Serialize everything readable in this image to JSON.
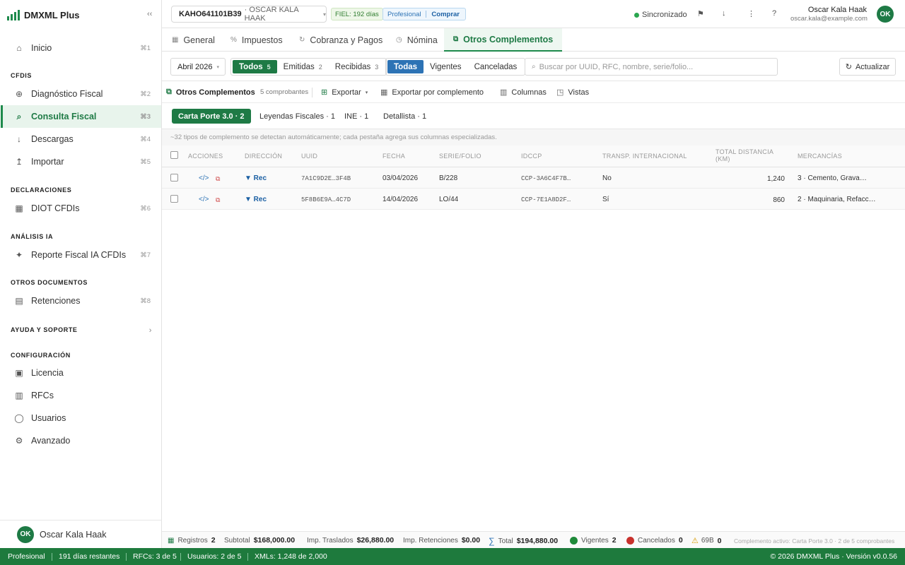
{
  "app": {
    "name": "DMXML Plus",
    "collapse_icon": "‹‹"
  },
  "sidebar": {
    "sections": {
      "cfdis": "CFDIS",
      "declaraciones": "DECLARACIONES",
      "analisis": "ANÁLISIS IA",
      "otros": "OTROS DOCUMENTOS",
      "ayuda": "AYUDA Y SOPORTE",
      "config": "CONFIGURACIÓN"
    },
    "items": {
      "inicio": {
        "label": "Inicio",
        "kbd": "⌘1",
        "icon": "home-icon"
      },
      "diagnostico": {
        "label": "Diagnóstico Fiscal",
        "kbd": "⌘2",
        "icon": "diagnostic-icon"
      },
      "consulta": {
        "label": "Consulta Fiscal",
        "kbd": "⌘3",
        "icon": "search-icon"
      },
      "descargas": {
        "label": "Descargas",
        "kbd": "⌘4",
        "icon": "download-icon"
      },
      "importar": {
        "label": "Importar",
        "kbd": "⌘5",
        "icon": "upload-icon"
      },
      "diot": {
        "label": "DIOT CFDIs",
        "kbd": "⌘6",
        "icon": "grid-icon"
      },
      "reporte": {
        "label": "Reporte Fiscal IA CFDIs",
        "kbd": "⌘7",
        "icon": "sparkle-icon"
      },
      "retenciones": {
        "label": "Retenciones",
        "kbd": "⌘8",
        "icon": "document-icon"
      },
      "licencia": {
        "label": "Licencia",
        "icon": "license-icon"
      },
      "rfcs": {
        "label": "RFCs",
        "icon": "building-icon"
      },
      "usuarios": {
        "label": "Usuarios",
        "icon": "users-icon"
      },
      "avanzado": {
        "label": "Avanzado",
        "icon": "gear-icon"
      }
    },
    "ayuda_chevron": "›",
    "user": {
      "initials": "OK",
      "name": "Oscar Kala Haak"
    }
  },
  "topbar": {
    "rfc": "KAHO641101B39",
    "rfc_name": "· OSCAR KALA HAAK",
    "fiel": "FIEL: 192 días",
    "plan": "Profesional",
    "buy": "Comprar",
    "sync": "Sincronizado",
    "user_name": "Oscar Kala Haak",
    "user_email": "oscar.kala@example.com",
    "user_initials": "OK"
  },
  "tabs": [
    {
      "label": "General",
      "icon": "grid-icon"
    },
    {
      "label": "Impuestos",
      "icon": "percent-icon"
    },
    {
      "label": "Cobranza y Pagos",
      "icon": "cycle-icon"
    },
    {
      "label": "Nómina",
      "icon": "clock-icon"
    },
    {
      "label": "Otros Complementos",
      "icon": "copy-icon"
    }
  ],
  "filters": {
    "month": "Abril 2026",
    "direction": [
      {
        "label": "Todos",
        "count": "5"
      },
      {
        "label": "Emitidas",
        "count": "2"
      },
      {
        "label": "Recibidas",
        "count": "3"
      }
    ],
    "status": [
      "Todas",
      "Vigentes",
      "Canceladas"
    ],
    "search_placeholder": "Buscar por UUID, RFC, nombre, serie/folio...",
    "refresh": "Actualizar"
  },
  "toolbar": {
    "title": "Otros Complementos",
    "count": "5 comprobantes",
    "export": "Exportar",
    "export_by": "Exportar por complemento",
    "columns": "Columnas",
    "views": "Vistas"
  },
  "subtabs": [
    "Carta Porte 3.0 · 2",
    "Leyendas Fiscales · 1",
    "INE · 1",
    "Detallista · 1"
  ],
  "note": "~32 tipos de complemento se detectan automáticamente; cada pestaña agrega sus columnas especializadas.",
  "table": {
    "columns": [
      "ACCIONES",
      "DIRECCIÓN",
      "UUID",
      "FECHA",
      "SERIE/FOLIO",
      "IDCCP",
      "TRANSP. INTERNACIONAL",
      "TOTAL DISTANCIA (KM)",
      "MERCANCÍAS"
    ],
    "rows": [
      {
        "direccion": "▼ Rec",
        "uuid": "7A1C9D2E…3F4B",
        "fecha": "03/04/2026",
        "serie": "B/228",
        "idccp": "CCP-3A6C4F7B…",
        "transp": "No",
        "distancia": "1,240",
        "mercancias": "3 · Cemento, Grava…"
      },
      {
        "direccion": "▼ Rec",
        "uuid": "5F8B6E9A…4C7D",
        "fecha": "14/04/2026",
        "serie": "LO/44",
        "idccp": "CCP-7E1A8D2F…",
        "transp": "Sí",
        "distancia": "860",
        "mercancias": "2 · Maquinaria, Refacc…"
      }
    ]
  },
  "footer": {
    "registros_label": "Registros",
    "registros": "2",
    "subtotal_label": "Subtotal",
    "subtotal": "$168,000.00",
    "traslados_label": "Imp. Traslados",
    "traslados": "$26,880.00",
    "retenciones_label": "Imp. Retenciones",
    "retenciones": "$0.00",
    "total_label": "Total",
    "total": "$194,880.00",
    "vigentes_label": "Vigentes",
    "vigentes": "2",
    "cancelados_label": "Cancelados",
    "cancelados": "0",
    "x69b_label": "69B",
    "x69b": "0",
    "active": "Complemento activo: Carta Porte 3.0 · 2 de 5 comprobantes"
  },
  "statusbar": {
    "plan": "Profesional",
    "days": "191 días restantes",
    "rfcs": "RFCs: 3 de 5",
    "users": "Usuarios: 2 de 5",
    "xmls": "XMLs: 1,248 de 2,000",
    "copyright": "© 2026 DMXML Plus · Versión v0.0.56"
  },
  "colors": {
    "brand": "#1e7a45",
    "accent_blue": "#2d73b5",
    "danger": "#c8312c"
  }
}
